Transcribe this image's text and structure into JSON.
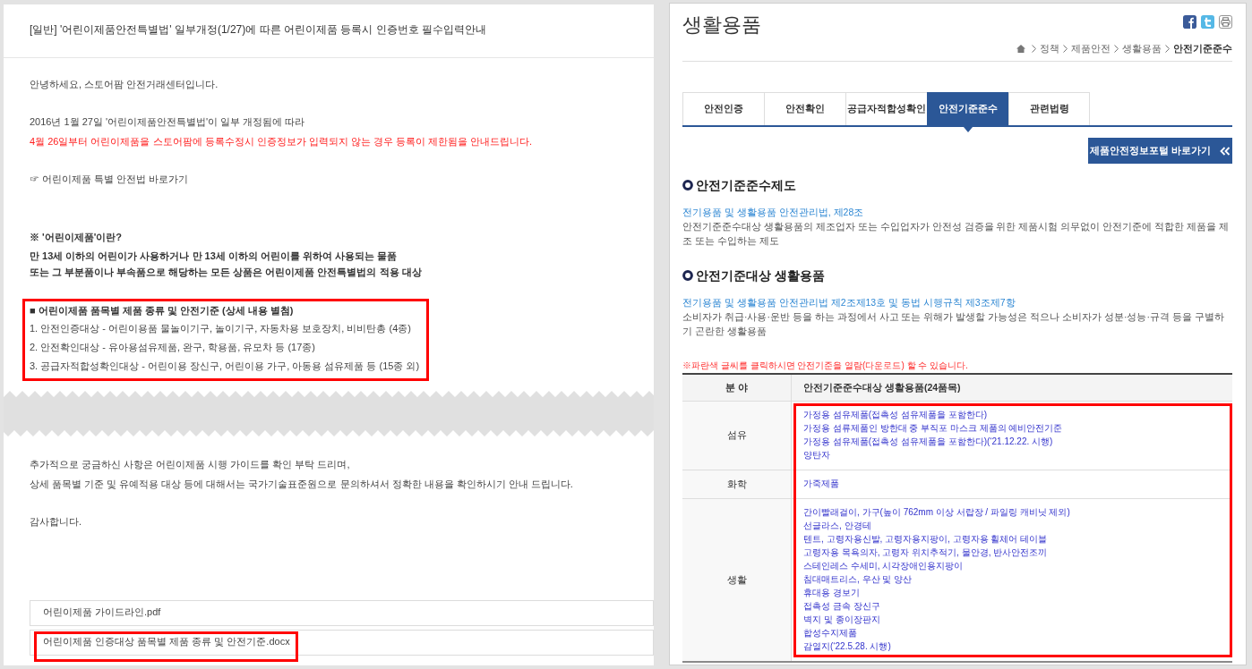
{
  "notice": {
    "title": "[일반] '어린이제품안전특별법' 일부개정(1/27)에 따른 어린이제품 등록시 인증번호 필수입력안내",
    "greeting": "안녕하세요, 스토어팜 안전거래센터입니다.",
    "intro": "2016년 1월 27일 '어린이제품안전특별법'이 일부 개정됨에 따라",
    "warning": "4월 26일부터 어린이제품을 스토어팜에 등록수정시 인증정보가 입력되지 않는 경우 등록이 제한됨을 안내드립니다.",
    "law_link": "☞ 어린이제품 특별 안전법 바로가기",
    "definition": {
      "heading": "※ '어린이제품'이란?",
      "lines": [
        "만 13세 이하의 어린이가 사용하거나 만 13세 이하의 어린이를 위하여 사용되는 물품",
        "또는 그 부분품이나 부속품으로 해당하는 모든 상품은 어린이제품 안전특별법의 적용 대상"
      ]
    },
    "categories": {
      "highlighted": true,
      "heading": "■ 어린이제품 품목별 제품 종류 및 안전기준 (상세 내용 별첨)",
      "items": [
        "1. 안전인증대상 - 어린이용품 물놀이기구, 놀이기구, 자동차용 보호장치, 비비탄총 (4종)",
        "2. 안전확인대상 - 유아용섬유제품, 완구, 학용품, 유모차 등 (17종)",
        "3. 공급자적합성확인대상 - 어린이용 장신구, 어린이용 가구, 아동용 섬유제품 등 (15종 외)"
      ]
    },
    "closing": [
      "추가적으로 궁금하신 사항은 어린이제품 시행 가이드를 확인 부탁 드리며,",
      "상세 품목별 기준 및 유예적용 대상 등에 대해서는 국가기술표준원으로 문의하셔서 정확한 내용을 확인하시기 안내 드립니다."
    ],
    "thanks": "감사합니다.",
    "attachments": [
      {
        "name": "어린이제품 가이드라인.pdf",
        "highlighted": false
      },
      {
        "name": "어린이제품 인증대상 품목별 제품 종류 및 안전기준.docx",
        "highlighted": true
      }
    ]
  },
  "product_page": {
    "title": "생활용품",
    "breadcrumb": [
      {
        "label": "정책",
        "current": false
      },
      {
        "label": "제품안전",
        "current": false
      },
      {
        "label": "생활용품",
        "current": false
      },
      {
        "label": "안전기준준수",
        "current": true
      }
    ],
    "tabs": [
      {
        "label": "안전인증",
        "selected": false
      },
      {
        "label": "안전확인",
        "selected": false
      },
      {
        "label": "공급자적합성확인",
        "selected": false
      },
      {
        "label": "안전기준준수",
        "selected": true
      },
      {
        "label": "관련법령",
        "selected": false
      }
    ],
    "portal_button": "제품안전정보포털 바로가기",
    "sections": [
      {
        "heading": "안전기준준수제도",
        "law_link": "전기용품 및 생활용품 안전관리법, 제28조",
        "description": "안전기준준수대상 생활용품의 제조업자 또는 수입업자가 안전성 검증을 위한 제품시험 의무없이 안전기준에 적합한 제품을 제조 또는 수입하는 제도"
      },
      {
        "heading": "안전기준대상 생활용품",
        "law_link": "전기용품 및 생활용품 안전관리법 제2조제13호 및 동법 시행규칙 제3조제7항",
        "description": "소비자가 취급·사용·운반 등을 하는 과정에서 사고 또는 위해가 발생할 가능성은 적으나 소비자가 성분·성능·규격 등을 구별하기 곤란한 생활용품"
      }
    ],
    "note": "※파란색 글씨를 클릭하시면 안전기준을 열람(다운로드) 할 수 있습니다.",
    "table": {
      "columns": [
        "분 야",
        "안전기준준수대상 생활용품(24품목)"
      ],
      "highlighted": true,
      "rows": [
        {
          "category": "섬유",
          "items": [
            "가정용 섬유제품(접촉성 섬유제품을 포함한다)",
            "가정용 섬류제품인 방한대 중 부직포 마스크 제품의 예비안전기준",
            "가정용 섬유제품(접촉성 섬유제품을 포함한다)(‘21.12.22. 시행)",
            "양탄자"
          ]
        },
        {
          "category": "화학",
          "items": [
            "가죽제품"
          ]
        },
        {
          "category": "생활",
          "items": [
            "간이빨래걸이, 가구(높이 762mm 이상 서랍장 / 파일링 캐비닛 제외)",
            "선글라스, 안경테",
            "텐트, 고령자용신발, 고령자용지팡이, 고령자용 휠체어 테이블",
            "고령자용 목욕의자, 고령자 위치추적기, 물안경, 반사안전조끼",
            "스테인레스 수세미, 시각장애인용지팡이",
            "침대매트리스, 우산 및 양산",
            "휴대용 경보기",
            "접촉성 금속 장신구",
            "벽지 및 종이장판지",
            "합성수지제품",
            "감열지(‘22.5.28. 시행)"
          ]
        }
      ]
    }
  }
}
